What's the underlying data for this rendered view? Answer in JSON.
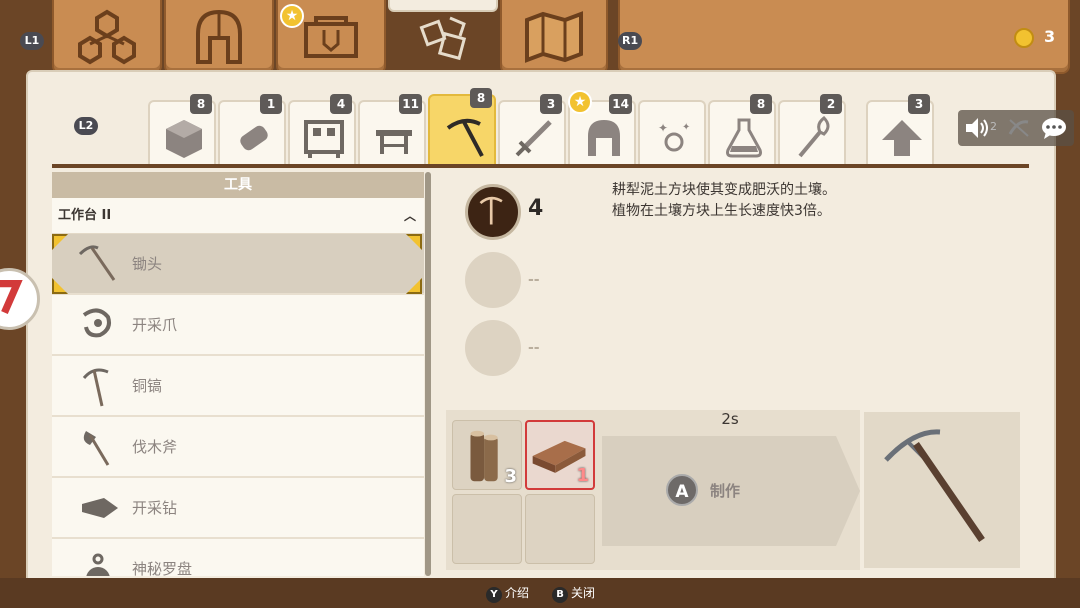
{
  "top_bar": {
    "left_button": "L1",
    "right_button": "R1",
    "coin_count": "3",
    "tabs": [
      {
        "name": "resources",
        "icon": "resources-icon"
      },
      {
        "name": "armor",
        "icon": "helmet-icon"
      },
      {
        "name": "bags",
        "icon": "bag-icon",
        "starred": true
      },
      {
        "name": "crafting",
        "icon": "crafting-icon",
        "active": true
      },
      {
        "name": "map",
        "icon": "map-icon"
      }
    ]
  },
  "sub_tabs": {
    "left_button": "L2",
    "items": [
      {
        "count": "8",
        "icon": "block-icon"
      },
      {
        "count": "1",
        "icon": "scroll-icon"
      },
      {
        "count": "4",
        "icon": "machine-icon"
      },
      {
        "count": "11",
        "icon": "table-icon"
      },
      {
        "count": "8",
        "icon": "pickaxe-icon",
        "active": true
      },
      {
        "count": "3",
        "icon": "sword-icon"
      },
      {
        "count": "14",
        "icon": "helmet-icon",
        "starred": true
      },
      {
        "count": "",
        "icon": "sparkle-icon"
      },
      {
        "count": "8",
        "icon": "potion-icon"
      },
      {
        "count": "2",
        "icon": "torch-icon"
      },
      {
        "count": "3",
        "icon": "arrow-up-icon"
      }
    ]
  },
  "list": {
    "header": "工具",
    "group": "工作台 II",
    "items": [
      {
        "label": "锄头",
        "selected": true
      },
      {
        "label": "开采爪"
      },
      {
        "label": "铜镐"
      },
      {
        "label": "伐木斧"
      },
      {
        "label": "开采钻"
      },
      {
        "label": "神秘罗盘"
      }
    ]
  },
  "detail": {
    "stat_value": "4",
    "empty_1": "--",
    "empty_2": "--",
    "description_1": "耕犁泥土方块使其变成肥沃的土壤。",
    "description_2": "植物在土壤方块上生长速度快3倍。"
  },
  "craft": {
    "time": "2s",
    "button_key": "A",
    "button_label": "制作",
    "ingredients": [
      {
        "icon": "wood-log-icon",
        "qty": "3"
      },
      {
        "icon": "copper-bar-icon",
        "qty": "1",
        "insufficient": true
      }
    ]
  },
  "footer": {
    "hint1_key": "Y",
    "hint1_label": "介绍",
    "hint2_key": "B",
    "hint2_label": "关闭"
  },
  "side_ui": {
    "badge": "2"
  },
  "colors": {
    "wood": "#c98c52",
    "paper": "#f3ecdf",
    "active_tab": "#f7d668",
    "highlight_red": "#d23a3a",
    "gold": "#f2c230"
  }
}
